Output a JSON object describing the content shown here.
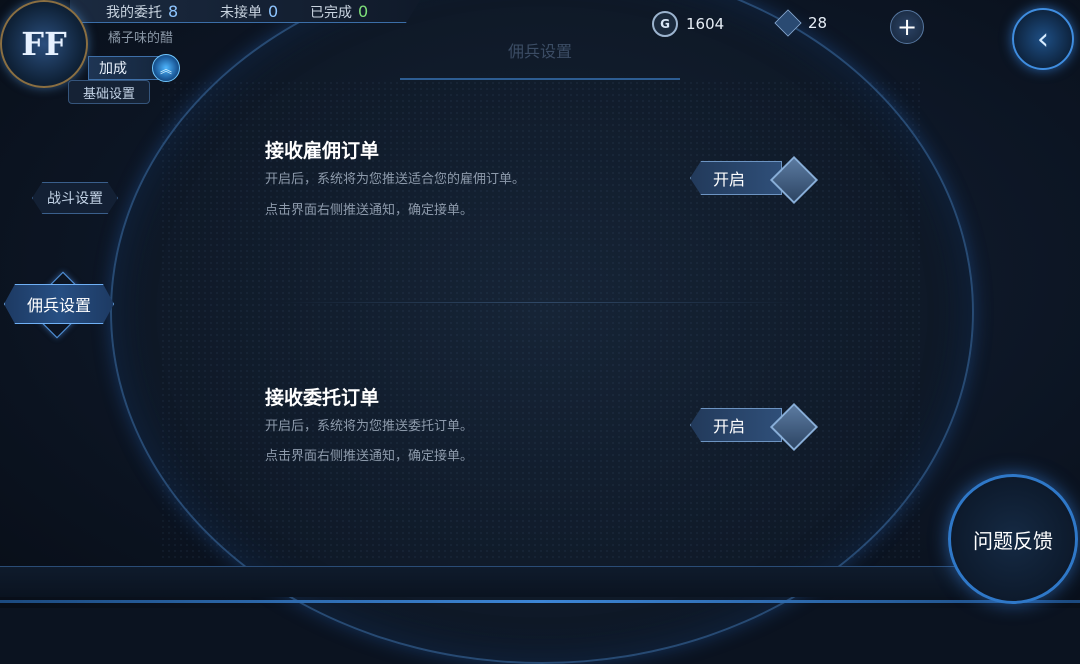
{
  "header": {
    "stats": [
      {
        "label": "我的委托",
        "value": "8"
      },
      {
        "label": "未接单",
        "value": "0"
      },
      {
        "label": "已完成",
        "value": "0"
      }
    ],
    "nickname": "橘子味的醋",
    "bonus_label": "加成",
    "currency": {
      "gold": "1604",
      "gold_icon_letter": "G",
      "gems": "28"
    },
    "plus_symbol": "+",
    "back_symbol": "‹",
    "avatar_text": "FF",
    "page_title": "佣兵设置"
  },
  "sidebar": {
    "items": [
      {
        "label": "基础设置"
      },
      {
        "label": "战斗设置"
      },
      {
        "label": "佣兵设置"
      }
    ]
  },
  "settings": [
    {
      "title": "接收雇佣订单",
      "desc1": "开启后，系统将为您推送适合您的雇佣订单。",
      "desc2": "点击界面右侧推送通知，确定接单。",
      "toggle_label": "开启"
    },
    {
      "title": "接收委托订单",
      "desc1": "开启后，系统将为您推送委托订单。",
      "desc2": "点击界面右侧推送通知，确定接单。",
      "toggle_label": "开启"
    }
  ],
  "feedback_label": "问题反馈",
  "colors": {
    "accent": "#3f8de0",
    "green": "#7fe07a",
    "blue_num": "#8ec5ff"
  }
}
